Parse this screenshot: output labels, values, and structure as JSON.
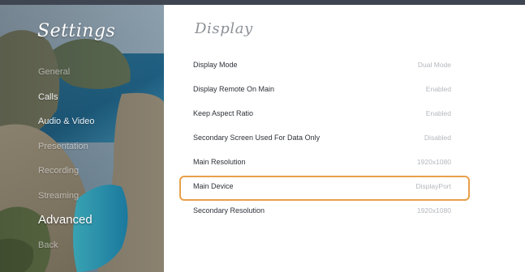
{
  "sidebar": {
    "title": "Settings",
    "items": [
      {
        "label": "General"
      },
      {
        "label": "Calls"
      },
      {
        "label": "Audio & Video"
      },
      {
        "label": "Presentation"
      },
      {
        "label": "Recording"
      },
      {
        "label": "Streaming"
      },
      {
        "label": "Advanced"
      },
      {
        "label": "Back"
      }
    ],
    "active_item": "Advanced"
  },
  "panel": {
    "title": "Display",
    "rows": [
      {
        "label": "Display Mode",
        "value": "Dual Mode"
      },
      {
        "label": "Display Remote On Main",
        "value": "Enabled"
      },
      {
        "label": "Keep Aspect Ratio",
        "value": "Enabled"
      },
      {
        "label": "Secondary Screen Used For Data Only",
        "value": "Disabled"
      },
      {
        "label": "Main Resolution",
        "value": "1920x1080"
      },
      {
        "label": "Main Device",
        "value": "DisplayPort"
      },
      {
        "label": "Secondary Resolution",
        "value": "1920x1080"
      }
    ],
    "focused_row": "Main Device"
  },
  "colors": {
    "focus_outline": "#e8a04a",
    "top_bar": "#3f4652",
    "panel_background": "#ffffff"
  }
}
